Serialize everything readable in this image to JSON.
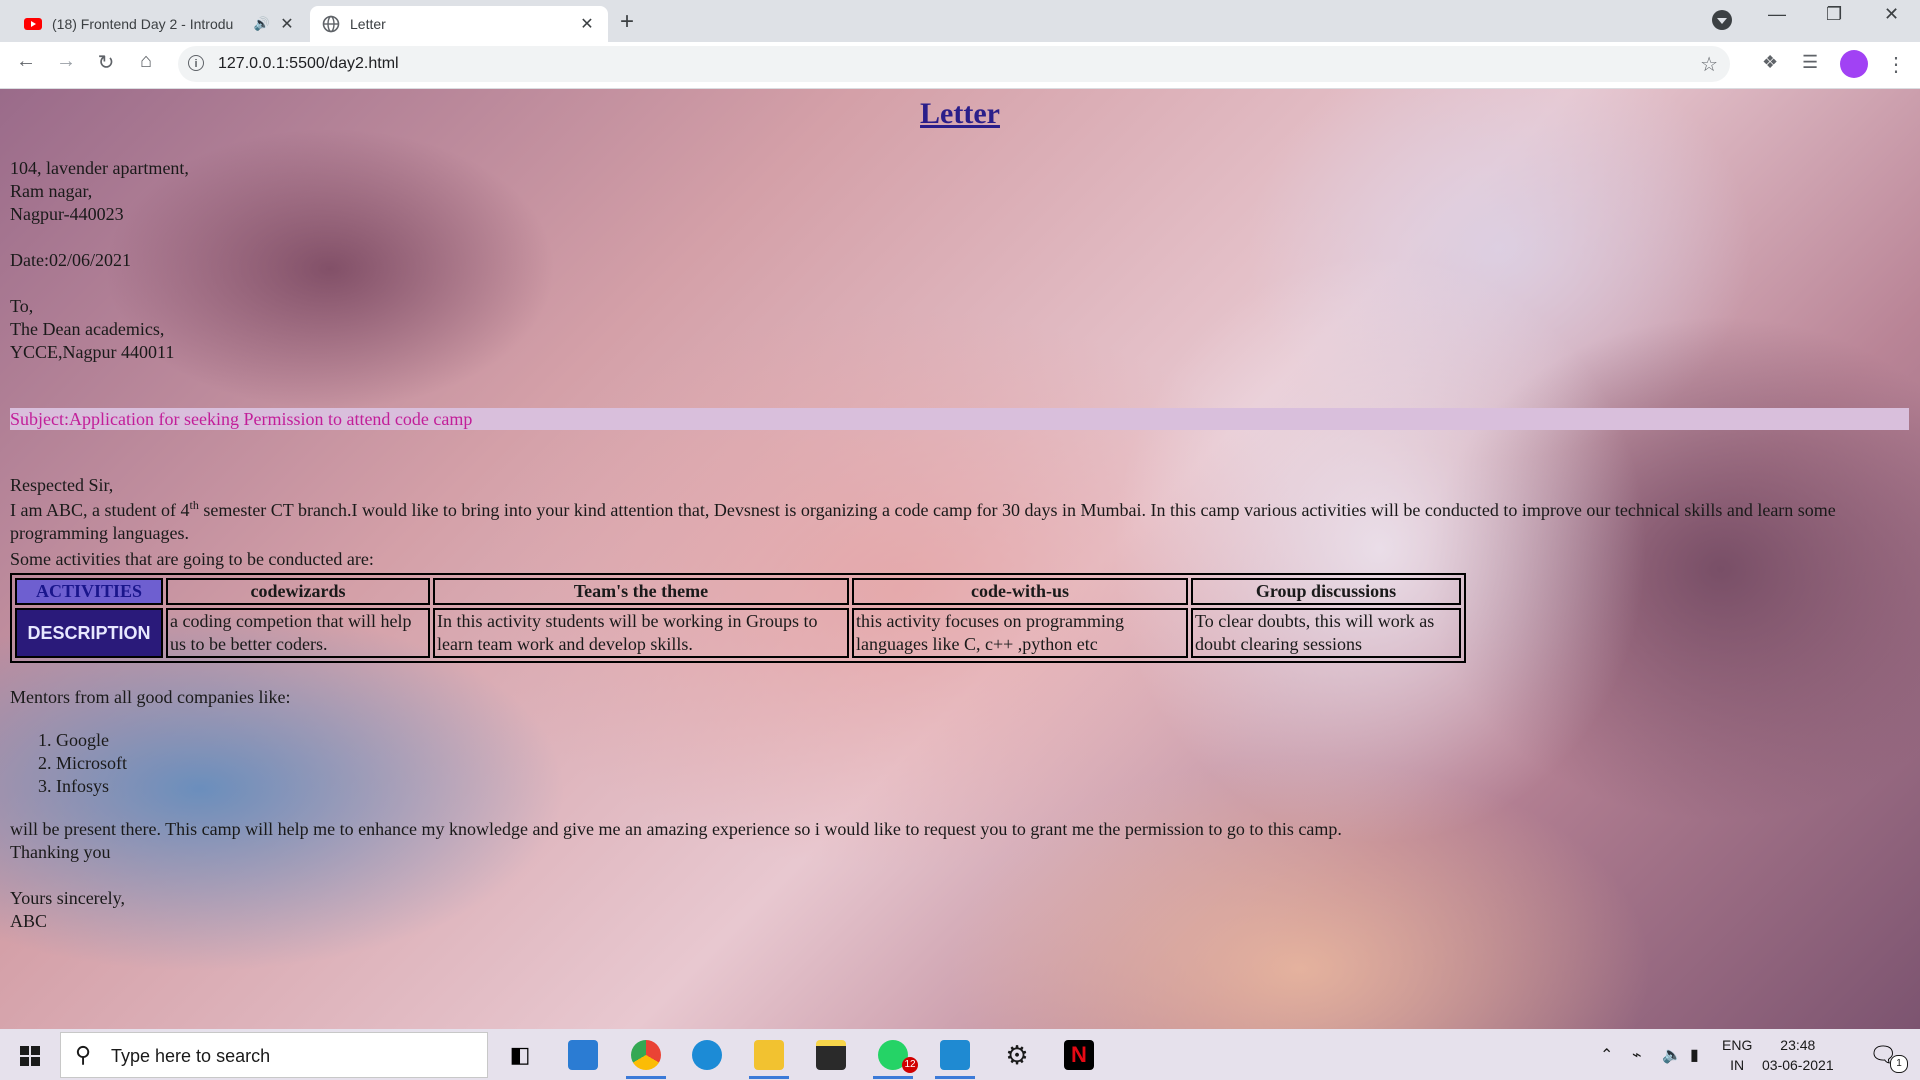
{
  "browser": {
    "tabs": [
      {
        "title": "(18) Frontend Day 2 - Introdu",
        "icon": "youtube-icon",
        "state": "inactive"
      },
      {
        "title": "Letter",
        "icon": "globe-icon",
        "state": "active"
      }
    ],
    "new_tab": "+",
    "url": "127.0.0.1:5500/day2.html"
  },
  "page": {
    "title": "Letter",
    "address": [
      "104, lavender apartment,",
      "Ram nagar,",
      "Nagpur-440023"
    ],
    "date": "Date:02/06/2021",
    "to": [
      "To,",
      "The Dean academics,",
      "YCCE,Nagpur 440011"
    ],
    "subject": "Subject:Application for seeking Permission to attend code camp",
    "salutation": "Respected Sir,",
    "body_intro_pre": "I am ABC, a student of 4",
    "body_intro_sup": "th",
    "body_intro_post": " semester CT branch.I would like to bring into your kind attention that, Devsnest is organizing a code camp for 30 days in Mumbai. In this camp various activities will be conducted to improve our technical skills and learn some programming languages.",
    "activities_intro": "Some activities that are going to be conducted are:",
    "table": {
      "header_label": "ACTIVITIES",
      "description_label": "DESCRIPTION",
      "activities": [
        "codewizards",
        "Team's the theme",
        "code-with-us",
        "Group discussions"
      ],
      "descriptions": [
        "a coding competion that will help us to be better coders.",
        "In this activity students will be working in Groups to learn team work and develop skills.",
        "this activity focuses on programming languages like C, c++ ,python etc",
        "To clear doubts, this will work as doubt clearing sessions"
      ]
    },
    "mentors_intro": "Mentors from all good companies like:",
    "mentors": [
      "1. Google",
      "2. Microsoft",
      "3. Infosys"
    ],
    "closing_para": "will be present there. This camp will help me to enhance my knowledge and give me an amazing experience so i would like to request you to grant me the permission to go to this camp.",
    "thanks": "Thanking you",
    "signoff": "Yours sincerely,",
    "signature": "ABC"
  },
  "taskbar": {
    "search_placeholder": "Type here to search",
    "lang_top": "ENG",
    "lang_bottom": "IN",
    "time": "23:48",
    "date": "03-06-2021",
    "whatsapp_badge": "12",
    "notification_count": "1"
  },
  "colors": {
    "title": "#2a1e8a",
    "subject_bg": "#d9bfdc",
    "subject_text": "#c21e99",
    "activities_bg": "#6e5fd0",
    "description_bg": "#2a1a7a"
  }
}
